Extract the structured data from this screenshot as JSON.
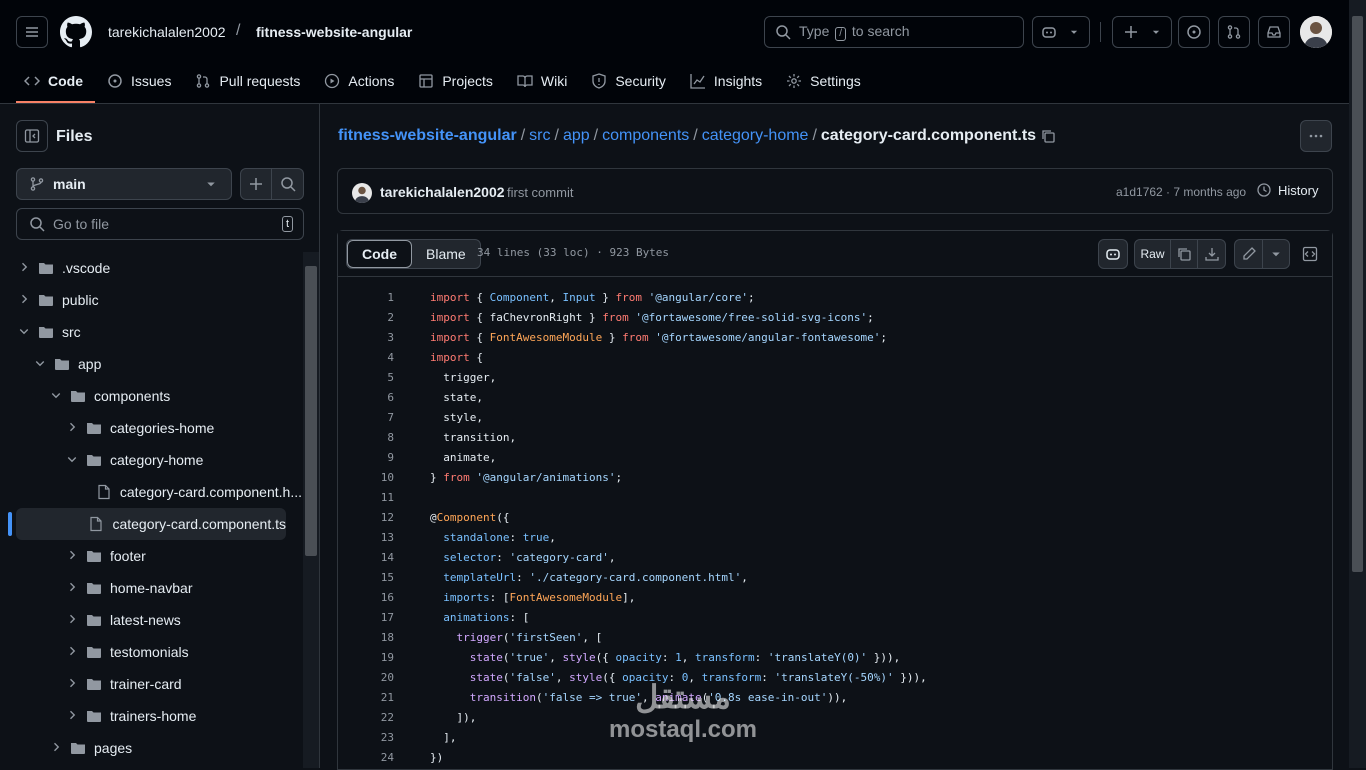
{
  "header": {
    "owner": "tarekichalalen2002",
    "slash": "/",
    "repo": "fitness-website-angular",
    "search_pre": "Type",
    "search_key": "/",
    "search_post": "to search"
  },
  "tabs": [
    {
      "label": "Code",
      "icon": "code-icon"
    },
    {
      "label": "Issues",
      "icon": "issue-icon"
    },
    {
      "label": "Pull requests",
      "icon": "pull-request-icon"
    },
    {
      "label": "Actions",
      "icon": "play-icon"
    },
    {
      "label": "Projects",
      "icon": "table-icon"
    },
    {
      "label": "Wiki",
      "icon": "book-icon"
    },
    {
      "label": "Security",
      "icon": "shield-icon"
    },
    {
      "label": "Insights",
      "icon": "graph-icon"
    },
    {
      "label": "Settings",
      "icon": "gear-icon"
    }
  ],
  "sidebar": {
    "title": "Files",
    "branch": "main",
    "go_to_file": "Go to file",
    "go_to_file_key": "t",
    "tree": [
      {
        "label": ".vscode",
        "type": "folder",
        "depth": 0,
        "open": false
      },
      {
        "label": "public",
        "type": "folder",
        "depth": 0,
        "open": false
      },
      {
        "label": "src",
        "type": "folder",
        "depth": 0,
        "open": true
      },
      {
        "label": "app",
        "type": "folder",
        "depth": 1,
        "open": true
      },
      {
        "label": "components",
        "type": "folder",
        "depth": 2,
        "open": true
      },
      {
        "label": "categories-home",
        "type": "folder",
        "depth": 3,
        "open": false
      },
      {
        "label": "category-home",
        "type": "folder",
        "depth": 3,
        "open": true
      },
      {
        "label": "category-card.component.h...",
        "type": "file",
        "depth": 4
      },
      {
        "label": "category-card.component.ts",
        "type": "file",
        "depth": 4,
        "selected": true
      },
      {
        "label": "footer",
        "type": "folder",
        "depth": 3,
        "open": false
      },
      {
        "label": "home-navbar",
        "type": "folder",
        "depth": 3,
        "open": false
      },
      {
        "label": "latest-news",
        "type": "folder",
        "depth": 3,
        "open": false
      },
      {
        "label": "testomonials",
        "type": "folder",
        "depth": 3,
        "open": false
      },
      {
        "label": "trainer-card",
        "type": "folder",
        "depth": 3,
        "open": false
      },
      {
        "label": "trainers-home",
        "type": "folder",
        "depth": 3,
        "open": false
      },
      {
        "label": "pages",
        "type": "folder",
        "depth": 2,
        "open": false
      }
    ]
  },
  "breadcrumb": {
    "parts": [
      "fitness-website-angular",
      "src",
      "app",
      "components",
      "category-home"
    ],
    "current": "category-card.component.ts"
  },
  "commit": {
    "author": "tarekichalalen2002",
    "message": "first commit",
    "meta": "a1d1762 · 7 months ago",
    "history": "History"
  },
  "file": {
    "tab_code": "Code",
    "tab_blame": "Blame",
    "info": "34 lines (33 loc) · 923 Bytes",
    "raw": "Raw",
    "code_lines": [
      [
        [
          "k",
          "import"
        ],
        [
          "t",
          " { "
        ],
        [
          "v",
          "Component"
        ],
        [
          "t",
          ", "
        ],
        [
          "v",
          "Input"
        ],
        [
          "t",
          " } "
        ],
        [
          "k",
          "from"
        ],
        [
          "t",
          " "
        ],
        [
          "s",
          "'@angular/core'"
        ],
        [
          "t",
          ";"
        ]
      ],
      [
        [
          "k",
          "import"
        ],
        [
          "t",
          " { faChevronRight } "
        ],
        [
          "k",
          "from"
        ],
        [
          "t",
          " "
        ],
        [
          "s",
          "'@fortawesome/free-solid-svg-icons'"
        ],
        [
          "t",
          ";"
        ]
      ],
      [
        [
          "k",
          "import"
        ],
        [
          "t",
          " { "
        ],
        [
          "c",
          "FontAwesomeModule"
        ],
        [
          "t",
          " } "
        ],
        [
          "k",
          "from"
        ],
        [
          "t",
          " "
        ],
        [
          "s",
          "'@fortawesome/angular-fontawesome'"
        ],
        [
          "t",
          ";"
        ]
      ],
      [
        [
          "k",
          "import"
        ],
        [
          "t",
          " {"
        ]
      ],
      [
        [
          "t",
          "  trigger,"
        ]
      ],
      [
        [
          "t",
          "  state,"
        ]
      ],
      [
        [
          "t",
          "  style,"
        ]
      ],
      [
        [
          "t",
          "  transition,"
        ]
      ],
      [
        [
          "t",
          "  animate,"
        ]
      ],
      [
        [
          "t",
          "} "
        ],
        [
          "k",
          "from"
        ],
        [
          "t",
          " "
        ],
        [
          "s",
          "'@angular/animations'"
        ],
        [
          "t",
          ";"
        ]
      ],
      [
        [
          "t",
          ""
        ]
      ],
      [
        [
          "t",
          "@"
        ],
        [
          "c",
          "Component"
        ],
        [
          "t",
          "({"
        ]
      ],
      [
        [
          "t",
          "  "
        ],
        [
          "v",
          "standalone"
        ],
        [
          "t",
          ": "
        ],
        [
          "v",
          "true"
        ],
        [
          "t",
          ","
        ]
      ],
      [
        [
          "t",
          "  "
        ],
        [
          "v",
          "selector"
        ],
        [
          "t",
          ": "
        ],
        [
          "s",
          "'category-card'"
        ],
        [
          "t",
          ","
        ]
      ],
      [
        [
          "t",
          "  "
        ],
        [
          "v",
          "templateUrl"
        ],
        [
          "t",
          ": "
        ],
        [
          "s",
          "'./category-card.component.html'"
        ],
        [
          "t",
          ","
        ]
      ],
      [
        [
          "t",
          "  "
        ],
        [
          "v",
          "imports"
        ],
        [
          "t",
          ": ["
        ],
        [
          "c",
          "FontAwesomeModule"
        ],
        [
          "t",
          "],"
        ]
      ],
      [
        [
          "t",
          "  "
        ],
        [
          "v",
          "animations"
        ],
        [
          "t",
          ": ["
        ]
      ],
      [
        [
          "t",
          "    "
        ],
        [
          "f",
          "trigger"
        ],
        [
          "t",
          "("
        ],
        [
          "s",
          "'firstSeen'"
        ],
        [
          "t",
          ", ["
        ]
      ],
      [
        [
          "t",
          "      "
        ],
        [
          "f",
          "state"
        ],
        [
          "t",
          "("
        ],
        [
          "s",
          "'true'"
        ],
        [
          "t",
          ", "
        ],
        [
          "f",
          "style"
        ],
        [
          "t",
          "({ "
        ],
        [
          "v",
          "opacity"
        ],
        [
          "t",
          ": "
        ],
        [
          "v",
          "1"
        ],
        [
          "t",
          ", "
        ],
        [
          "v",
          "transform"
        ],
        [
          "t",
          ": "
        ],
        [
          "s",
          "'translateY(0)'"
        ],
        [
          "t",
          " })),"
        ]
      ],
      [
        [
          "t",
          "      "
        ],
        [
          "f",
          "state"
        ],
        [
          "t",
          "("
        ],
        [
          "s",
          "'false'"
        ],
        [
          "t",
          ", "
        ],
        [
          "f",
          "style"
        ],
        [
          "t",
          "({ "
        ],
        [
          "v",
          "opacity"
        ],
        [
          "t",
          ": "
        ],
        [
          "v",
          "0"
        ],
        [
          "t",
          ", "
        ],
        [
          "v",
          "transform"
        ],
        [
          "t",
          ": "
        ],
        [
          "s",
          "'translateY(-50%)'"
        ],
        [
          "t",
          " })),"
        ]
      ],
      [
        [
          "t",
          "      "
        ],
        [
          "f",
          "transition"
        ],
        [
          "t",
          "("
        ],
        [
          "s",
          "'false => true'"
        ],
        [
          "t",
          ", "
        ],
        [
          "f",
          "animate"
        ],
        [
          "t",
          "("
        ],
        [
          "s",
          "'0.8s ease-in-out'"
        ],
        [
          "t",
          ")),"
        ]
      ],
      [
        [
          "t",
          "    ]),"
        ]
      ],
      [
        [
          "t",
          "  ],"
        ]
      ],
      [
        [
          "t",
          "})"
        ]
      ]
    ]
  },
  "watermark": {
    "arabic": "مستقل",
    "latin": "mostaql.com"
  },
  "colors": {
    "accent": "#4493f8",
    "tab_underline": "#f78166",
    "keyword": "#ff7b72",
    "string": "#a5d6ff",
    "constant": "#79c0ff",
    "function": "#d2a8ff",
    "entity": "#ffa657"
  }
}
